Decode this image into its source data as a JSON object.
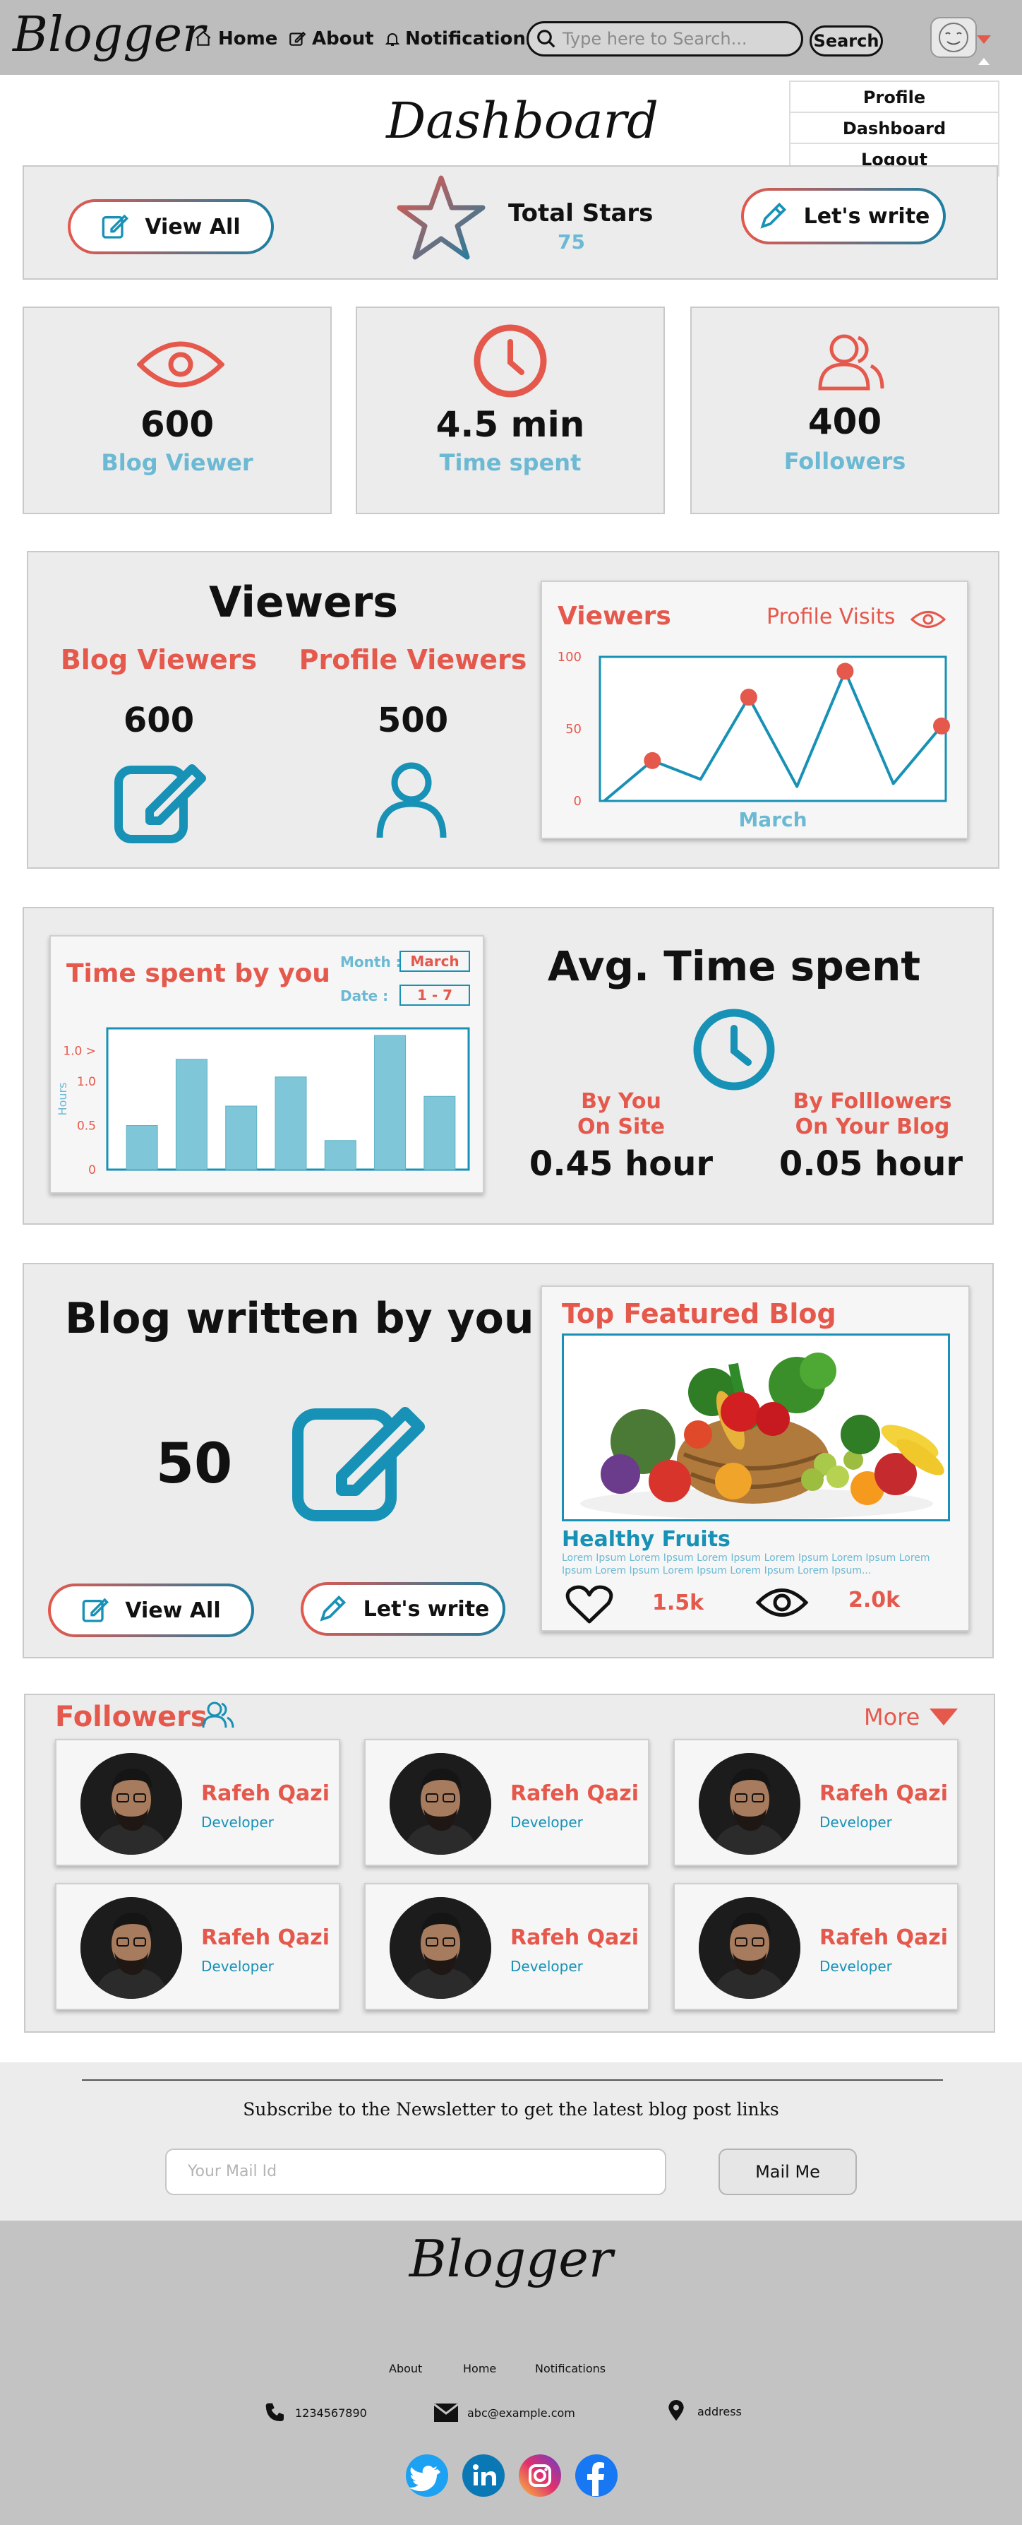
{
  "nav": {
    "logo": "Blogger",
    "home": "Home",
    "about": "About",
    "notifications": "Notifications",
    "search_placeholder": "Type here to Search...",
    "search_button": "Search"
  },
  "dropdown": {
    "items": [
      "Profile",
      "Dashboard",
      "Logout"
    ]
  },
  "page_title": "Dashboard",
  "top_bar": {
    "view_all": "View All",
    "total_stars_label": "Total Stars",
    "total_stars_value": "75",
    "lets_write": "Let's write"
  },
  "stats": [
    {
      "value": "600",
      "label": "Blog Viewer",
      "icon": "eye-icon"
    },
    {
      "value": "4.5 min",
      "label": "Time spent",
      "icon": "clock-icon"
    },
    {
      "value": "400",
      "label": "Followers",
      "icon": "followers-icon"
    }
  ],
  "viewers": {
    "title": "Viewers",
    "blog_label": "Blog Viewers",
    "blog_value": "600",
    "profile_label": "Profile Viewers",
    "profile_value": "500"
  },
  "viewers_chart_card": {
    "title": "Viewers",
    "profile_visits": "Profile Visits",
    "xlabel": "March"
  },
  "time_chart_card": {
    "title": "Time spent by you",
    "month_label": "Month :",
    "month_value": "March",
    "date_label": "Date :",
    "date_value": "1 - 7"
  },
  "avg_time": {
    "title": "Avg. Time spent",
    "by_you_l1": "By You",
    "by_you_l2": "On Site",
    "by_you_value": "0.45 hour",
    "by_followers_l1": "By Folllowers",
    "by_followers_l2": "On Your Blog",
    "by_followers_value": "0.05 hour"
  },
  "blog_written": {
    "title": "Blog written by you",
    "count": "50",
    "view_all": "View All",
    "lets_write": "Let's write"
  },
  "featured": {
    "title": "Top Featured Blog",
    "post_title": "Healthy Fruits",
    "excerpt_line1": "Lorem Ipsum Lorem Ipsum Lorem Ipsum Lorem Ipsum Lorem Ipsum Lorem",
    "excerpt_line2": "Ipsum Lorem Ipsum Lorem Ipsum Lorem Ipsum Lorem Ipsum...",
    "likes": "1.5k",
    "views": "2.0k"
  },
  "followers": {
    "title": "Followers",
    "more": "More",
    "people": [
      {
        "name": "Rafeh Qazi",
        "role": "Developer"
      },
      {
        "name": "Rafeh Qazi",
        "role": "Developer"
      },
      {
        "name": "Rafeh Qazi",
        "role": "Developer"
      },
      {
        "name": "Rafeh Qazi",
        "role": "Developer"
      },
      {
        "name": "Rafeh Qazi",
        "role": "Developer"
      },
      {
        "name": "Rafeh Qazi",
        "role": "Developer"
      }
    ]
  },
  "newsletter": {
    "text": "Subscribe to the Newsletter to get the latest blog post links",
    "placeholder": "Your Mail Id",
    "button": "Mail Me"
  },
  "footer": {
    "logo": "Blogger",
    "links": [
      "About",
      "Home",
      "Notifications"
    ],
    "phone": "1234567890",
    "email": "abc@example.com",
    "address": "address",
    "social": [
      "twitter-icon",
      "linkedin-icon",
      "instagram-icon",
      "facebook-icon"
    ]
  },
  "chart_data": [
    {
      "type": "line",
      "title": "Viewers",
      "xlabel": "March",
      "ylabel": "",
      "ylim": [
        0,
        100
      ],
      "yticks": [
        0,
        50,
        100
      ],
      "x": [
        1,
        2,
        3,
        4,
        5,
        6,
        7,
        8
      ],
      "values": [
        0,
        28,
        15,
        72,
        10,
        90,
        12,
        52
      ],
      "series": [
        {
          "name": "Profile Visits",
          "values": [
            0,
            28,
            15,
            72,
            10,
            90,
            12,
            52
          ]
        }
      ],
      "marked_points": [
        1,
        3,
        5,
        7
      ],
      "grid": false,
      "colors": {
        "line": "#1791b5",
        "marker": "#e5584c"
      }
    },
    {
      "type": "bar",
      "title": "Time spent by you",
      "ylabel": "Hours",
      "yticks": [
        "0",
        "0.5",
        "1.0",
        "1.0 >"
      ],
      "ylim": [
        0,
        1.6
      ],
      "categories": [
        "1",
        "2",
        "3",
        "4",
        "5",
        "6",
        "7"
      ],
      "values": [
        0.5,
        1.25,
        0.72,
        1.05,
        0.33,
        1.52,
        0.83
      ],
      "grid": false,
      "colors": {
        "bar": "#7ec6d8"
      }
    }
  ]
}
